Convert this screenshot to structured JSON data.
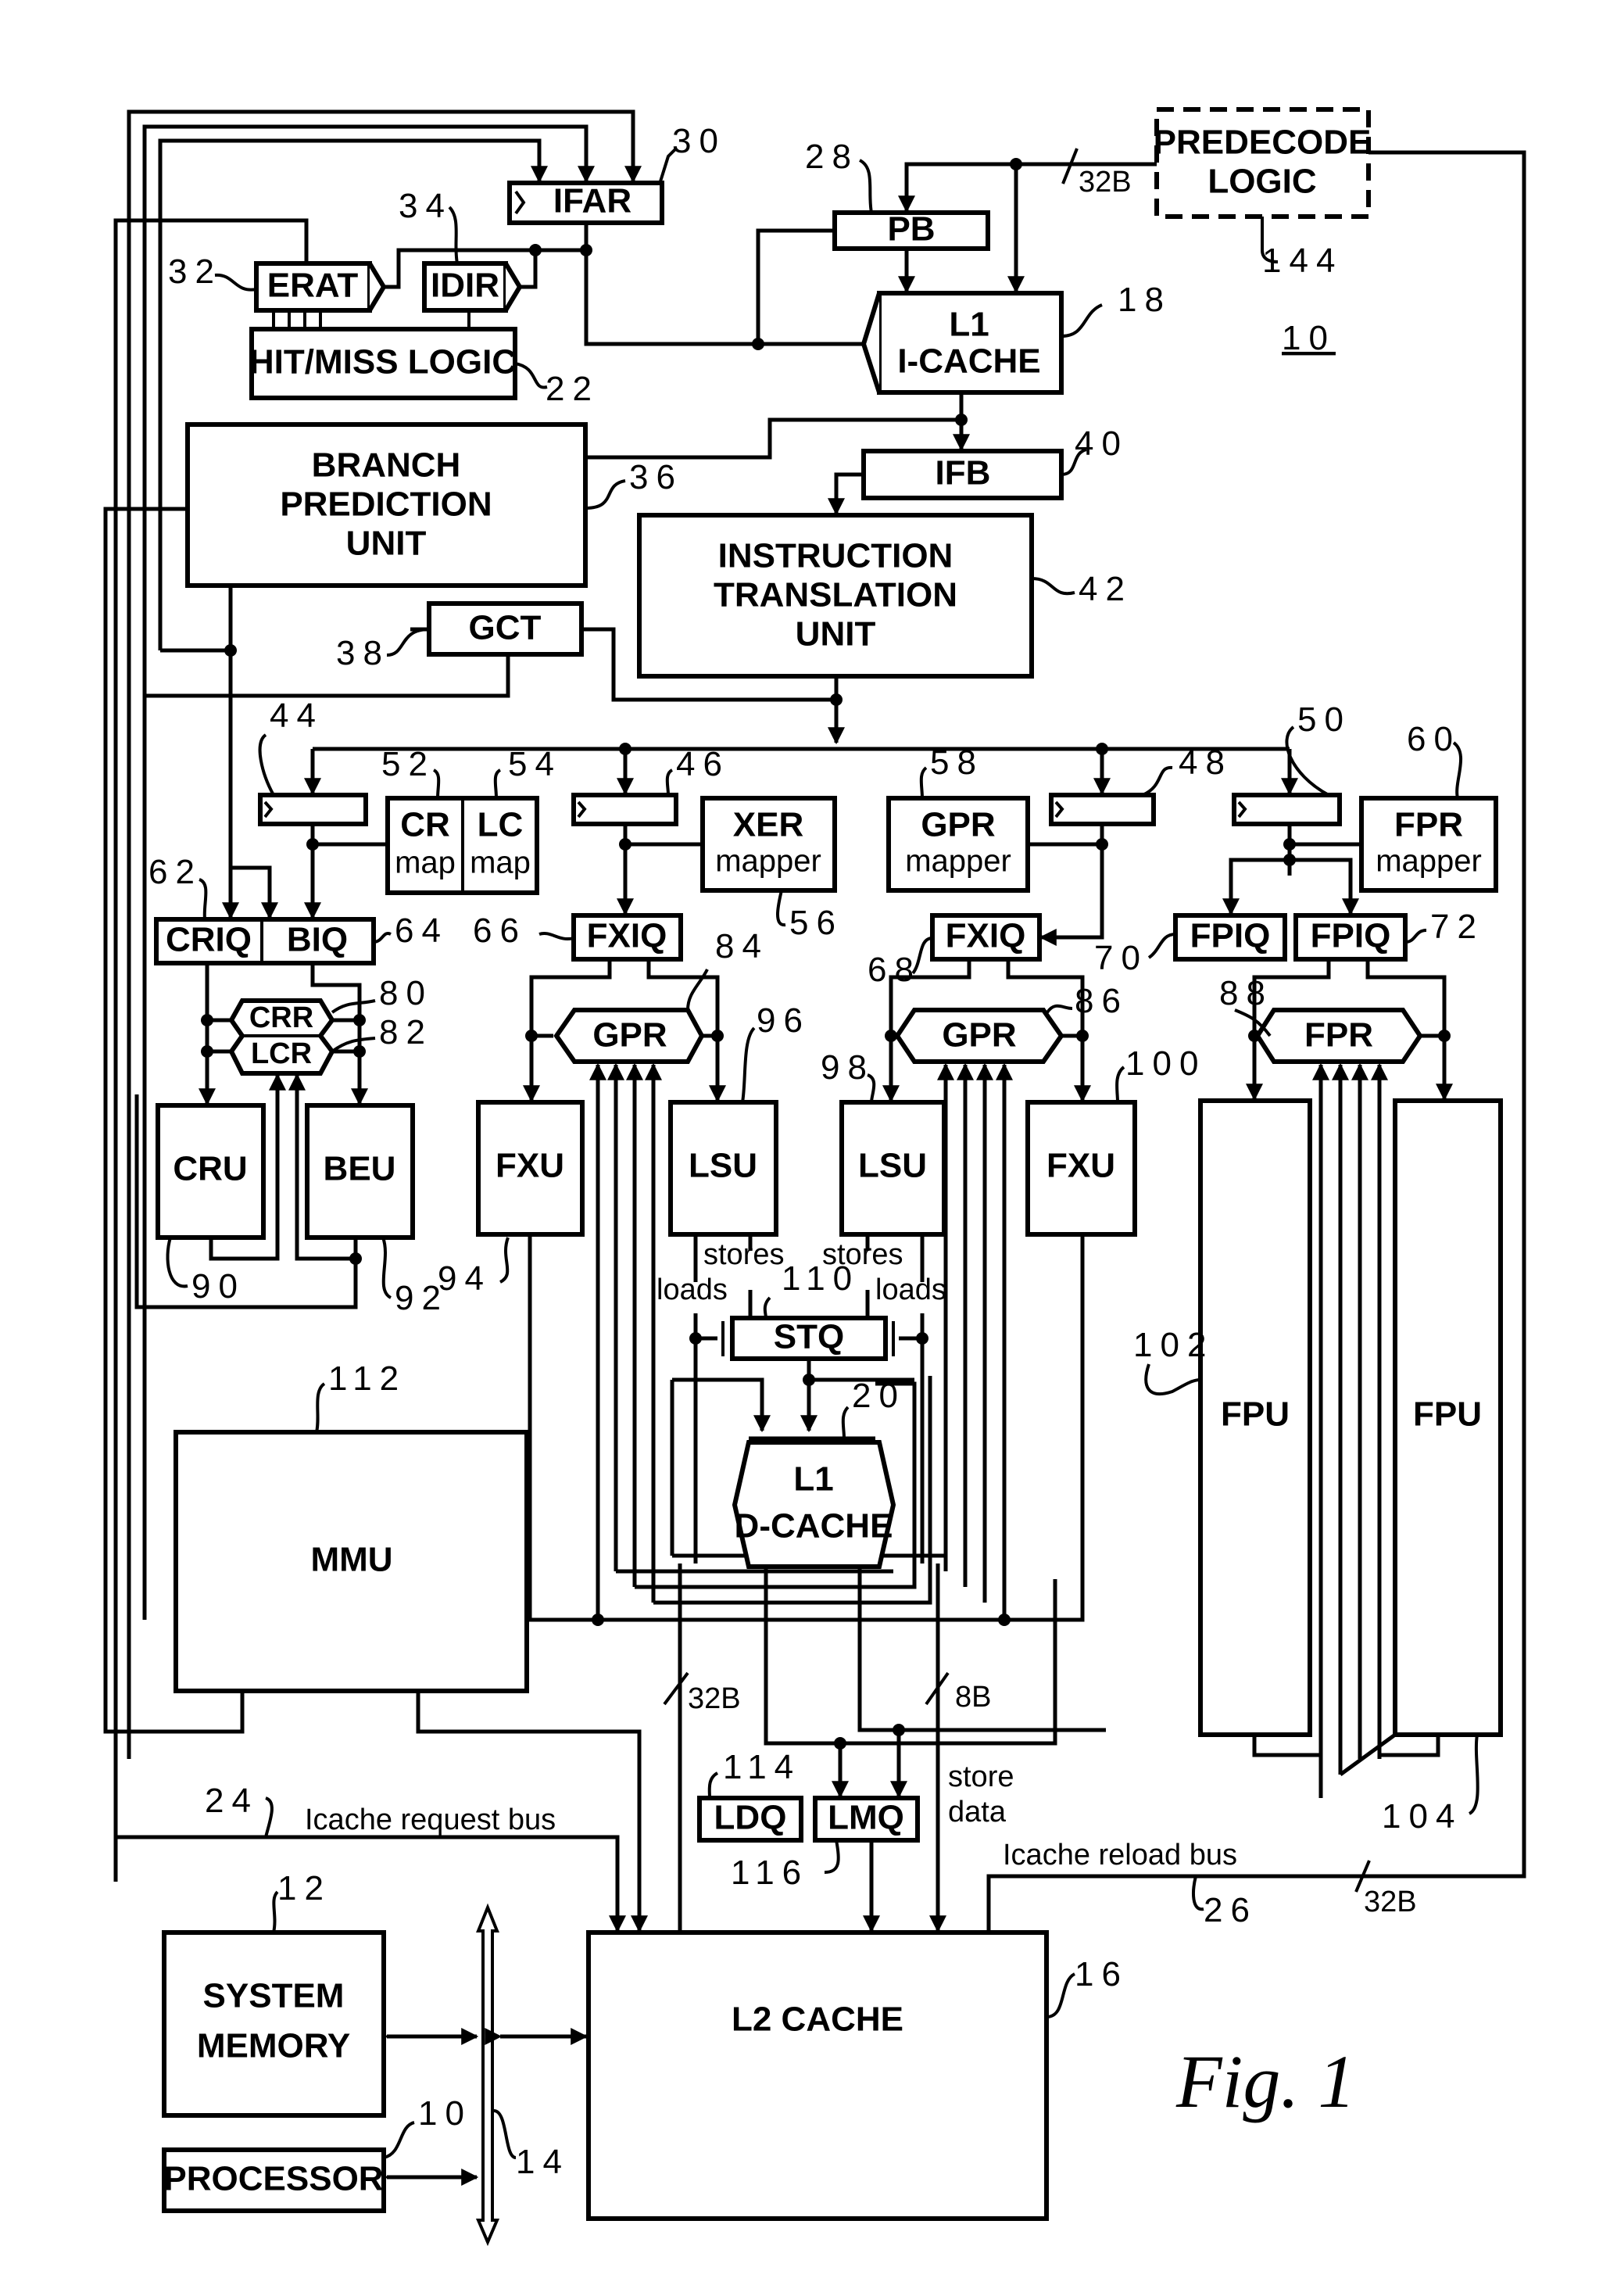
{
  "figure": {
    "caption": "Fig. 1",
    "system_ref": "10"
  },
  "blocks": {
    "ifar": {
      "label": "IFAR",
      "ref": "30"
    },
    "erat": {
      "label": "ERAT",
      "ref": "32"
    },
    "idir": {
      "label": "IDIR",
      "ref": "34"
    },
    "hitmiss": {
      "label": "HIT/MISS LOGIC",
      "ref": "22"
    },
    "pb": {
      "label": "PB",
      "ref": "28"
    },
    "predecode": {
      "line1": "PREDECODE",
      "line2": "LOGIC",
      "ref": "144"
    },
    "icache": {
      "line1": "L1",
      "line2": "I-CACHE",
      "ref": "18"
    },
    "bpu": {
      "line1": "BRANCH",
      "line2": "PREDICTION",
      "line3": "UNIT",
      "ref": "36"
    },
    "ifb": {
      "label": "IFB",
      "ref": "40"
    },
    "itu": {
      "line1": "INSTRUCTION",
      "line2": "TRANSLATION",
      "line3": "UNIT",
      "ref": "42"
    },
    "gct": {
      "label": "GCT",
      "ref": "38"
    },
    "latch44": {
      "ref": "44"
    },
    "latch46": {
      "ref": "46"
    },
    "latch48": {
      "ref": "48"
    },
    "latch50": {
      "ref": "50"
    },
    "crmap": {
      "line1": "CR",
      "line2": "map",
      "ref": "52"
    },
    "lcmap": {
      "line1": "LC",
      "line2": "map",
      "ref": "54"
    },
    "xermapper": {
      "line1": "XER",
      "line2": "mapper",
      "ref": "56"
    },
    "gprmapper": {
      "line1": "GPR",
      "line2": "mapper",
      "ref": "58"
    },
    "fprmapper": {
      "line1": "FPR",
      "line2": "mapper",
      "ref": "60"
    },
    "criq": {
      "label": "CRIQ",
      "ref": "62"
    },
    "biq": {
      "label": "BIQ",
      "ref": "64"
    },
    "fxiq66": {
      "label": "FXIQ",
      "ref": "66"
    },
    "fxiq68": {
      "label": "FXIQ",
      "ref": "68"
    },
    "fpiq70": {
      "label": "FPIQ",
      "ref": "70"
    },
    "fpiq72": {
      "label": "FPIQ",
      "ref": "72"
    },
    "crr": {
      "label": "CRR",
      "ref": "80"
    },
    "lcr": {
      "label": "LCR",
      "ref": "82"
    },
    "gpr84": {
      "label": "GPR",
      "ref": "84"
    },
    "gpr86": {
      "label": "GPR",
      "ref": "86"
    },
    "fpr88": {
      "label": "FPR",
      "ref": "88"
    },
    "cru": {
      "label": "CRU",
      "ref": "90"
    },
    "beu": {
      "label": "BEU",
      "ref": "92"
    },
    "fxu94": {
      "label": "FXU",
      "ref": "94"
    },
    "lsu96": {
      "label": "LSU",
      "ref": "96"
    },
    "lsu98": {
      "label": "LSU",
      "ref": "98"
    },
    "fxu100": {
      "label": "FXU",
      "ref": "100"
    },
    "fpu102": {
      "label": "FPU",
      "ref": "102"
    },
    "fpu104": {
      "label": "FPU",
      "ref": "104"
    },
    "stq": {
      "label": "STQ",
      "ref": "110"
    },
    "dcache": {
      "line1": "L1",
      "line2": "D-CACHE",
      "ref": "20"
    },
    "mmu": {
      "label": "MMU",
      "ref": "112"
    },
    "ldq": {
      "label": "LDQ",
      "ref": "114"
    },
    "lmq": {
      "label": "LMQ",
      "ref": "116"
    },
    "l2": {
      "label": "L2 CACHE",
      "ref": "16"
    },
    "sysmem": {
      "line1": "SYSTEM",
      "line2": "MEMORY",
      "ref": "12"
    },
    "processor": {
      "label": "PROCESSOR",
      "ref": "10"
    },
    "bus": {
      "ref": "14"
    }
  },
  "annotations": {
    "predecode_width": "32B",
    "dcache_l2_width": "32B",
    "lmq_width": "8B",
    "reload_width": "32B",
    "stores_left": "stores",
    "stores_right": "stores",
    "loads_left": "loads",
    "loads_right": "loads",
    "store_data_1": "store",
    "store_data_2": "data",
    "icache_request_bus": "Icache request bus",
    "icache_request_ref": "24",
    "icache_reload_bus": "Icache reload bus",
    "icache_reload_ref": "26"
  }
}
